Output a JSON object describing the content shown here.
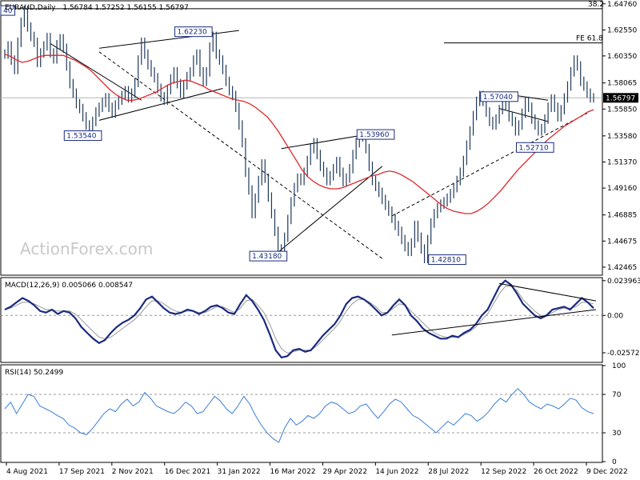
{
  "header": {
    "symbol": "EURAUD,Daily",
    "ohlc": "1.56784 1.57252 1.56155 1.56797"
  },
  "watermark": "ActionForex.com",
  "chart_data": [
    {
      "type": "line",
      "title": "EURAUD,Daily",
      "subtitle": "1.56784 1.57252 1.56155 1.56797",
      "x": [
        "4 Aug 2021",
        "17 Sep 2021",
        "2 Nov 2021",
        "16 Dec 2021",
        "31 Jan 2022",
        "16 Mar 2022",
        "29 Apr 2022",
        "14 Jun 2022",
        "28 Jul 2022",
        "12 Sep 2022",
        "26 Oct 2022",
        "9 Dec 2022"
      ],
      "ylim": [
        1.4185,
        1.6495
      ],
      "y_ticks": [
        "1.64760",
        "1.62550",
        "1.60350",
        "1.58065",
        "1.55850",
        "1.53580",
        "1.51370",
        "1.49160",
        "1.46885",
        "1.44675",
        "1.42465"
      ],
      "last_price": "1.56797",
      "series": [
        {
          "role": "price bars",
          "color": "#1f3a5c",
          "values": [
            1.605,
            1.612,
            1.6,
            1.592,
            1.615,
            1.632,
            1.642,
            1.628,
            1.62,
            1.615,
            1.598,
            1.606,
            1.612,
            1.619,
            1.606,
            1.601,
            1.613,
            1.618,
            1.61,
            1.595,
            1.58,
            1.572,
            1.563,
            1.559,
            1.552,
            1.545,
            1.542,
            1.548,
            1.556,
            1.56,
            1.564,
            1.568,
            1.56,
            1.555,
            1.562,
            1.566,
            1.57,
            1.574,
            1.568,
            1.572,
            1.581,
            1.6,
            1.615,
            1.605,
            1.596,
            1.59,
            1.585,
            1.576,
            1.569,
            1.566,
            1.575,
            1.584,
            1.59,
            1.58,
            1.572,
            1.579,
            1.586,
            1.59,
            1.6,
            1.605,
            1.59,
            1.582,
            1.59,
            1.611,
            1.62,
            1.605,
            1.6,
            1.592,
            1.582,
            1.574,
            1.57,
            1.56,
            1.545,
            1.53,
            1.505,
            1.49,
            1.47,
            1.483,
            1.498,
            1.512,
            1.5,
            1.484,
            1.47,
            1.455,
            1.44,
            1.437,
            1.45,
            1.465,
            1.48,
            1.492,
            1.5,
            1.498,
            1.505,
            1.515,
            1.525,
            1.53,
            1.52,
            1.51,
            1.505,
            1.498,
            1.502,
            1.508,
            1.514,
            1.505,
            1.497,
            1.5,
            1.508,
            1.52,
            1.53,
            1.535,
            1.537,
            1.525,
            1.51,
            1.498,
            1.493,
            1.488,
            1.482,
            1.477,
            1.472,
            1.466,
            1.46,
            1.455,
            1.448,
            1.442,
            1.438,
            1.445,
            1.46,
            1.45,
            1.44,
            1.432,
            1.448,
            1.462,
            1.47,
            1.475,
            1.478,
            1.48,
            1.483,
            1.487,
            1.492,
            1.498,
            1.505,
            1.515,
            1.528,
            1.54,
            1.553,
            1.565,
            1.57,
            1.565,
            1.556,
            1.548,
            1.545,
            1.55,
            1.558,
            1.566,
            1.562,
            1.552,
            1.548,
            1.54,
            1.545,
            1.555,
            1.565,
            1.56,
            1.55,
            1.545,
            1.54,
            1.542,
            1.55,
            1.56,
            1.567,
            1.56,
            1.552,
            1.558,
            1.568,
            1.578,
            1.59,
            1.6,
            1.595,
            1.582,
            1.578,
            1.572,
            1.568,
            1.568
          ]
        },
        {
          "role": "moving average",
          "color": "#e0282c",
          "values": [
            1.605,
            1.603,
            1.6,
            1.598,
            1.599,
            1.601,
            1.603,
            1.604,
            1.604,
            1.604,
            1.604,
            1.602,
            1.6,
            1.597,
            1.594,
            1.59,
            1.585,
            1.58,
            1.575,
            1.571,
            1.568,
            1.566,
            1.566,
            1.567,
            1.569,
            1.571,
            1.573,
            1.576,
            1.579,
            1.581,
            1.582,
            1.583,
            1.582,
            1.58,
            1.578,
            1.575,
            1.573,
            1.571,
            1.569,
            1.567,
            1.566,
            1.565,
            1.563,
            1.56,
            1.556,
            1.552,
            1.546,
            1.539,
            1.531,
            1.523,
            1.515,
            1.507,
            1.501,
            1.497,
            1.494,
            1.492,
            1.491,
            1.491,
            1.492,
            1.494,
            1.496,
            1.498,
            1.5,
            1.502,
            1.503,
            1.505,
            1.506,
            1.505,
            1.503,
            1.5,
            1.497,
            1.493,
            1.489,
            1.485,
            1.481,
            1.477,
            1.474,
            1.472,
            1.471,
            1.47,
            1.47,
            1.472,
            1.475,
            1.479,
            1.484,
            1.489,
            1.495,
            1.501,
            1.507,
            1.512,
            1.517,
            1.522,
            1.527,
            1.532,
            1.536,
            1.54,
            1.544,
            1.547,
            1.55,
            1.553,
            1.556,
            1.558
          ]
        }
      ],
      "annotations": {
        "swing_labels": [
          "40",
          "1.62230",
          "1.53540",
          "1.43180",
          "1.53960",
          "1.42810",
          "1.57040",
          "1.52710"
        ],
        "fib_labels": [
          "38.2",
          "FE 61.8"
        ],
        "level_38_2": 1.6435,
        "level_fe_61_8": 1.6145
      },
      "grid": false
    },
    {
      "type": "line",
      "title": "MACD(12,26,9) 0.005066 0.008547",
      "ylim": [
        -0.0318,
        0.0255
      ],
      "y_ticks": [
        "0.023963",
        "0.00",
        "-0.025726"
      ],
      "series": [
        {
          "role": "macd",
          "color": "#1a2b80",
          "values": [
            0.004,
            0.006,
            0.009,
            0.012,
            0.01,
            0.007,
            0.003,
            0.002,
            0.004,
            0.001,
            0.003,
            0.002,
            -0.002,
            -0.008,
            -0.012,
            -0.016,
            -0.019,
            -0.017,
            -0.012,
            -0.008,
            -0.005,
            -0.003,
            0.0,
            0.005,
            0.011,
            0.013,
            0.009,
            0.005,
            0.002,
            0.001,
            0.002,
            0.004,
            0.003,
            0.001,
            0.003,
            0.006,
            0.007,
            0.005,
            0.002,
            0.001,
            0.008,
            0.014,
            0.01,
            0.004,
            -0.003,
            -0.013,
            -0.024,
            -0.029,
            -0.028,
            -0.024,
            -0.023,
            -0.025,
            -0.024,
            -0.019,
            -0.014,
            -0.01,
            -0.006,
            0.0,
            0.008,
            0.012,
            0.013,
            0.011,
            0.008,
            0.004,
            0.0,
            0.002,
            0.007,
            0.011,
            0.007,
            0.0,
            -0.004,
            -0.009,
            -0.012,
            -0.014,
            -0.016,
            -0.016,
            -0.014,
            -0.015,
            -0.012,
            -0.01,
            -0.006,
            0.0,
            0.004,
            0.012,
            0.02,
            0.024,
            0.021,
            0.015,
            0.008,
            0.004,
            0.0,
            -0.002,
            0.0,
            0.004,
            0.005,
            0.006,
            0.004,
            0.008,
            0.012,
            0.009,
            0.005
          ]
        },
        {
          "role": "signal",
          "color": "#9a9a9a",
          "values": [
            0.004,
            0.005,
            0.007,
            0.009,
            0.009,
            0.008,
            0.006,
            0.004,
            0.004,
            0.003,
            0.003,
            0.003,
            0.001,
            -0.003,
            -0.007,
            -0.011,
            -0.015,
            -0.016,
            -0.015,
            -0.012,
            -0.009,
            -0.006,
            -0.003,
            0.001,
            0.006,
            0.01,
            0.01,
            0.008,
            0.005,
            0.003,
            0.002,
            0.003,
            0.003,
            0.002,
            0.002,
            0.004,
            0.006,
            0.006,
            0.004,
            0.002,
            0.005,
            0.01,
            0.011,
            0.007,
            0.002,
            -0.006,
            -0.016,
            -0.023,
            -0.026,
            -0.025,
            -0.024,
            -0.024,
            -0.024,
            -0.021,
            -0.017,
            -0.013,
            -0.009,
            -0.004,
            0.003,
            0.008,
            0.011,
            0.011,
            0.009,
            0.006,
            0.002,
            0.002,
            0.005,
            0.008,
            0.007,
            0.003,
            -0.001,
            -0.005,
            -0.009,
            -0.012,
            -0.014,
            -0.015,
            -0.015,
            -0.015,
            -0.013,
            -0.011,
            -0.008,
            -0.003,
            0.001,
            0.008,
            0.015,
            0.02,
            0.02,
            0.017,
            0.011,
            0.007,
            0.003,
            0.0,
            0.0,
            0.002,
            0.004,
            0.005,
            0.005,
            0.006,
            0.009,
            0.009,
            0.008
          ]
        }
      ]
    },
    {
      "type": "line",
      "title": "RSI(14) 50.2499",
      "ylim": [
        0,
        100
      ],
      "y_ticks": [
        "100",
        "70",
        "30",
        "0"
      ],
      "reference_levels": [
        70,
        30
      ],
      "series": [
        {
          "role": "rsi",
          "color": "#3a7fd6",
          "values": [
            55,
            62,
            50,
            60,
            70,
            68,
            58,
            55,
            52,
            48,
            45,
            38,
            35,
            30,
            28,
            34,
            42,
            50,
            55,
            52,
            60,
            65,
            58,
            62,
            72,
            66,
            58,
            55,
            52,
            50,
            55,
            62,
            58,
            50,
            52,
            60,
            68,
            63,
            55,
            50,
            58,
            68,
            60,
            48,
            38,
            30,
            24,
            20,
            35,
            45,
            38,
            42,
            48,
            45,
            50,
            58,
            62,
            60,
            55,
            50,
            52,
            58,
            60,
            52,
            45,
            52,
            60,
            65,
            62,
            55,
            48,
            45,
            40,
            35,
            30,
            36,
            42,
            38,
            44,
            50,
            48,
            42,
            46,
            52,
            60,
            66,
            62,
            70,
            76,
            70,
            62,
            58,
            55,
            60,
            58,
            55,
            60,
            66,
            64,
            56,
            52,
            50
          ]
        }
      ]
    }
  ],
  "x_axis": {
    "labels": [
      "4 Aug 2021",
      "17 Sep 2021",
      "2 Nov 2021",
      "16 Dec 2021",
      "31 Jan 2022",
      "16 Mar 2022",
      "29 Apr 2022",
      "14 Jun 2022",
      "28 Jul 2022",
      "12 Sep 2022",
      "26 Oct 2022",
      "9 Dec 2022"
    ]
  }
}
